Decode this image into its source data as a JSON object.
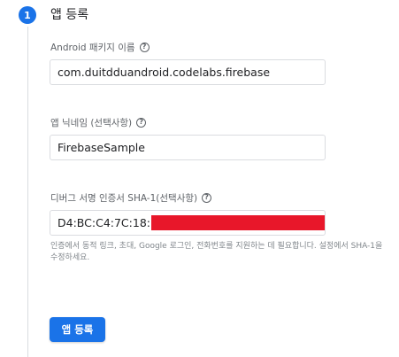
{
  "step": {
    "number": "1",
    "title": "앱 등록"
  },
  "fields": {
    "package_name": {
      "label": "Android 패키지 이름",
      "value": "com.duitdduandroid.codelabs.firebase"
    },
    "nickname": {
      "label": "앱 닉네임 (선택사항)",
      "value": "FirebaseSample"
    },
    "sha1": {
      "label": "디버그 서명 인증서 SHA-1(선택사항)",
      "value": "D4:BC:C4:7C:18:",
      "helper": "인증에서 동적 링크, 초대, Google 로그인, 전화번호를 지원하는 데 필요합니다. 설정에서 SHA-1을 수정하세요."
    }
  },
  "help_icon_glyph": "?",
  "register_button": {
    "label": "앱 등록"
  },
  "colors": {
    "accent": "#1a73e8",
    "redaction": "#e8172a"
  }
}
